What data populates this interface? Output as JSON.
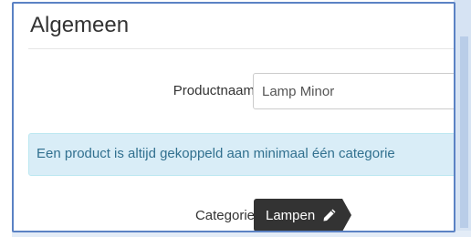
{
  "panel": {
    "title": "Algemeen"
  },
  "form": {
    "product_name": {
      "label": "Productnaam",
      "value": "Lamp Minor"
    },
    "info_message": "Een product is altijd gekoppeld aan minimaal één categorie",
    "category": {
      "label": "Categorie",
      "tag": "Lampen",
      "tag_icon": "pencil-icon"
    }
  },
  "colors": {
    "frame_border": "#5b82c4",
    "info_background": "#d9edf7",
    "info_text": "#31708f",
    "tag_background": "#333333"
  }
}
